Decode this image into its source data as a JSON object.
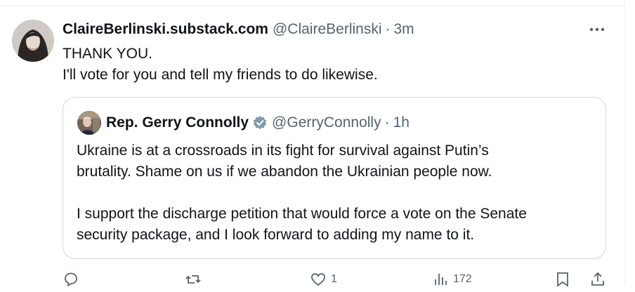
{
  "tweet": {
    "display_name": "ClaireBerlinski.substack.com",
    "handle": "@ClaireBerlinski",
    "separator": "·",
    "time": "3m",
    "text_lines": [
      "THANK YOU.",
      "I'll vote for you and tell my friends to do likewise."
    ],
    "more_icon": "more-horizontal-icon"
  },
  "quote": {
    "display_name": "Rep. Gerry Connolly",
    "verified_icon": "verified-badge-icon",
    "verified_color": "#829aab",
    "handle": "@GerryConnolly",
    "separator": "·",
    "time": "1h",
    "paragraph1": [
      "Ukraine is at a crossroads in its fight for survival against Putin’s",
      "brutality. Shame on us if we abandon the Ukrainian people now."
    ],
    "paragraph2": [
      "I support the discharge petition that would force a vote on the Senate",
      "security package, and I look forward to adding my name to it."
    ]
  },
  "actions": {
    "reply": {
      "icon": "reply-icon",
      "count": ""
    },
    "repost": {
      "icon": "repost-icon",
      "count": ""
    },
    "like": {
      "icon": "like-icon",
      "count": "1"
    },
    "views": {
      "icon": "views-icon",
      "count": "172"
    },
    "bookmark": {
      "icon": "bookmark-icon"
    },
    "share": {
      "icon": "share-icon"
    }
  }
}
